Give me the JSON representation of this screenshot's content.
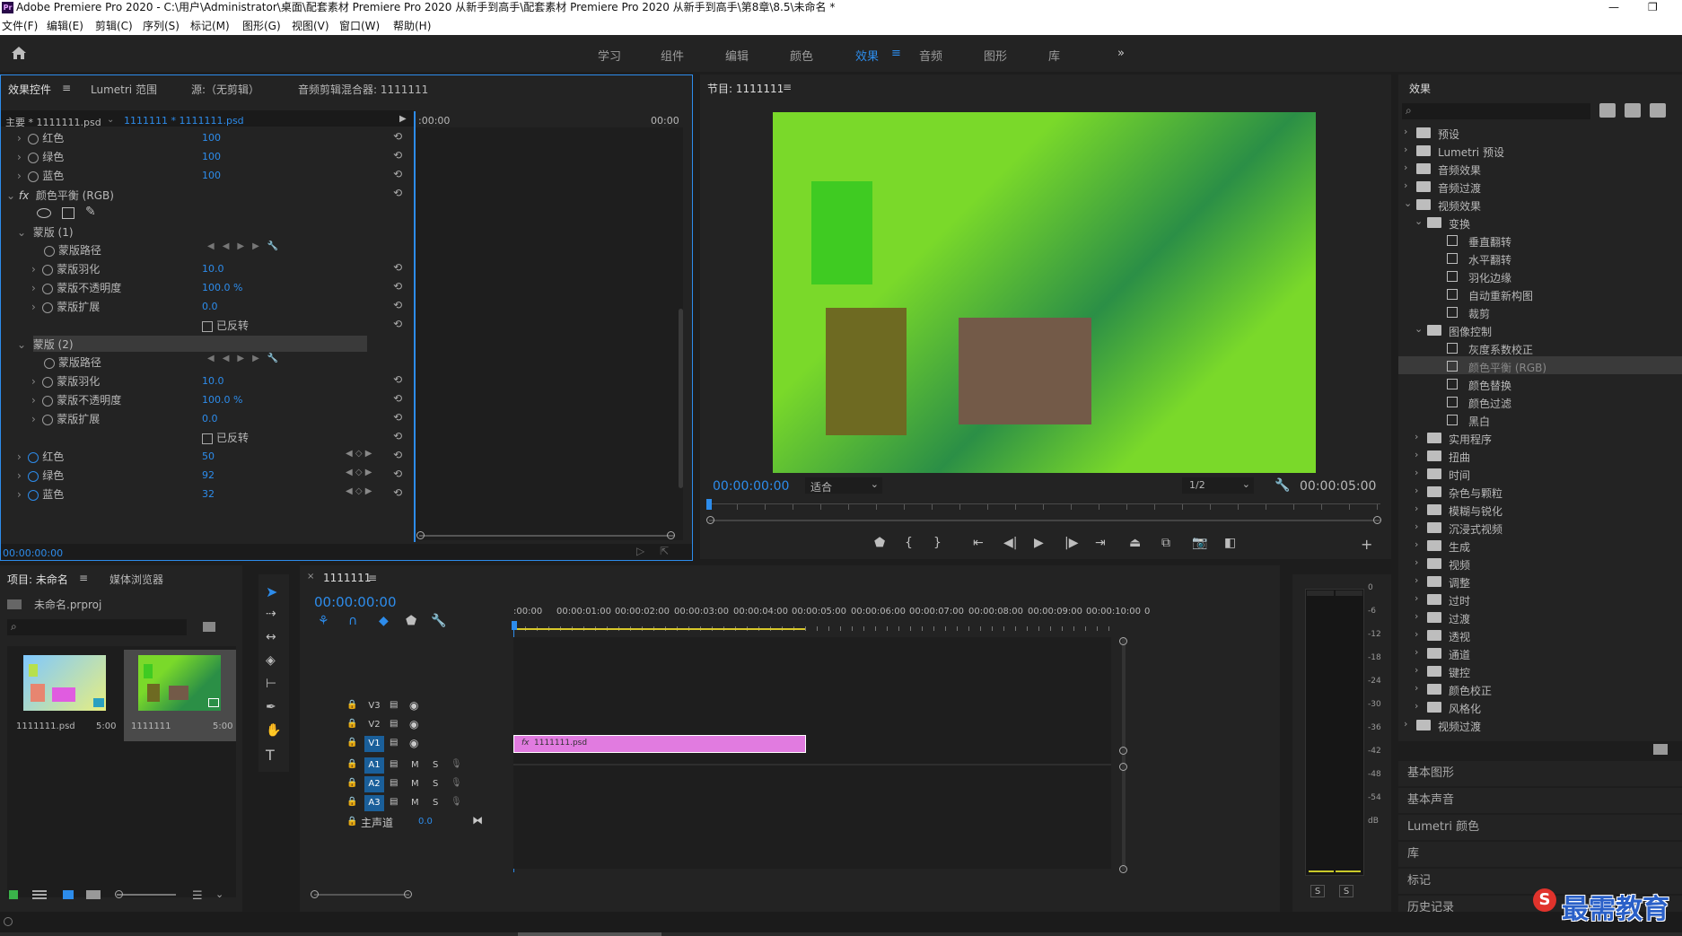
{
  "window": {
    "title": "Adobe Premiere Pro 2020 - C:\\用户\\Administrator\\桌面\\配套素材 Premiere Pro 2020 从新手到高手\\配套素材 Premiere Pro 2020 从新手到高手\\第8章\\8.5\\未命名 *",
    "logo": "Pr",
    "min": "—",
    "max": "❐"
  },
  "menu": [
    "文件(F)",
    "编辑(E)",
    "剪辑(C)",
    "序列(S)",
    "标记(M)",
    "图形(G)",
    "视图(V)",
    "窗口(W)",
    "帮助(H)"
  ],
  "workspaces": [
    "学习",
    "组件",
    "编辑",
    "颜色",
    "效果",
    "音频",
    "图形",
    "库"
  ],
  "workspace_active": "效果",
  "workspace_more": "»",
  "effect_controls": {
    "tabs": [
      "效果控件",
      "Lumetri 范围",
      "源:（无剪辑）",
      "音频剪辑混合器: 1111111"
    ],
    "master": "主要 * 1111111.psd",
    "clip": "1111111 * 1111111.psd",
    "time_start": ":00:00",
    "time_end": "00:00",
    "rows": [
      {
        "label": "红色",
        "value": "100"
      },
      {
        "label": "绿色",
        "value": "100"
      },
      {
        "label": "蓝色",
        "value": "100"
      }
    ],
    "effect_name": "颜色平衡 (RGB)",
    "fx": "fx",
    "mask1": "蒙版 (1)",
    "mask2": "蒙版 (2)",
    "mask_rows": [
      {
        "label": "蒙版路径",
        "value": ""
      },
      {
        "label": "蒙版羽化",
        "value": "10.0"
      },
      {
        "label": "蒙版不透明度",
        "value": "100.0 %"
      },
      {
        "label": "蒙版扩展",
        "value": "0.0"
      }
    ],
    "invert": "已反转",
    "bottom_rows": [
      {
        "label": "红色",
        "value": "50"
      },
      {
        "label": "绿色",
        "value": "92"
      },
      {
        "label": "蓝色",
        "value": "32"
      }
    ],
    "timecode": "00:00:00:00"
  },
  "program": {
    "title": "节目: 1111111",
    "timecode": "00:00:00:00",
    "fit": "适合",
    "resolution": "1/2",
    "duration": "00:00:05:00",
    "colors": {
      "bg1": "#7ad92a",
      "bg2": "#2b8f46",
      "rect1": "#3fcb22",
      "rect2": "#6e6a22",
      "rect3": "#735a48"
    }
  },
  "effects_panel": {
    "title": "效果",
    "tree": [
      {
        "label": "预设",
        "level": 0,
        "type": "folder-star"
      },
      {
        "label": "Lumetri 预设",
        "level": 0,
        "type": "folder-star"
      },
      {
        "label": "音频效果",
        "level": 0,
        "type": "folder"
      },
      {
        "label": "音频过渡",
        "level": 0,
        "type": "folder"
      },
      {
        "label": "视频效果",
        "level": 0,
        "type": "folder",
        "open": true
      },
      {
        "label": "变换",
        "level": 1,
        "type": "folder",
        "open": true
      },
      {
        "label": "垂直翻转",
        "level": 2,
        "type": "fx"
      },
      {
        "label": "水平翻转",
        "level": 2,
        "type": "fx"
      },
      {
        "label": "羽化边缘",
        "level": 2,
        "type": "fx"
      },
      {
        "label": "自动重新构图",
        "level": 2,
        "type": "fx"
      },
      {
        "label": "裁剪",
        "level": 2,
        "type": "fx"
      },
      {
        "label": "图像控制",
        "level": 1,
        "type": "folder",
        "open": true
      },
      {
        "label": "灰度系数校正",
        "level": 2,
        "type": "fx"
      },
      {
        "label": "颜色平衡 (RGB)",
        "level": 2,
        "type": "fx",
        "selected": true
      },
      {
        "label": "颜色替换",
        "level": 2,
        "type": "fx"
      },
      {
        "label": "颜色过滤",
        "level": 2,
        "type": "fx"
      },
      {
        "label": "黑白",
        "level": 2,
        "type": "fx"
      },
      {
        "label": "实用程序",
        "level": 1,
        "type": "folder"
      },
      {
        "label": "扭曲",
        "level": 1,
        "type": "folder"
      },
      {
        "label": "时间",
        "level": 1,
        "type": "folder"
      },
      {
        "label": "杂色与颗粒",
        "level": 1,
        "type": "folder"
      },
      {
        "label": "模糊与锐化",
        "level": 1,
        "type": "folder"
      },
      {
        "label": "沉浸式视频",
        "level": 1,
        "type": "folder"
      },
      {
        "label": "生成",
        "level": 1,
        "type": "folder"
      },
      {
        "label": "视频",
        "level": 1,
        "type": "folder"
      },
      {
        "label": "调整",
        "level": 1,
        "type": "folder"
      },
      {
        "label": "过时",
        "level": 1,
        "type": "folder"
      },
      {
        "label": "过渡",
        "level": 1,
        "type": "folder"
      },
      {
        "label": "透视",
        "level": 1,
        "type": "folder"
      },
      {
        "label": "通道",
        "level": 1,
        "type": "folder"
      },
      {
        "label": "键控",
        "level": 1,
        "type": "folder"
      },
      {
        "label": "颜色校正",
        "level": 1,
        "type": "folder"
      },
      {
        "label": "风格化",
        "level": 1,
        "type": "folder"
      },
      {
        "label": "视频过渡",
        "level": 0,
        "type": "folder"
      }
    ],
    "panels": [
      "基本图形",
      "基本声音",
      "Lumetri 颜色",
      "库",
      "标记",
      "历史记录"
    ]
  },
  "project": {
    "tabs": [
      "项目: 未命名",
      "媒体浏览器"
    ],
    "file": "未命名.prproj",
    "items": [
      {
        "name": "1111111.psd",
        "dur": "5:00"
      },
      {
        "name": "1111111",
        "dur": "5:00"
      }
    ]
  },
  "timeline": {
    "title": "1111111",
    "timecode": "00:00:00:00",
    "ruler": [
      ":00:00",
      "00:00:01:00",
      "00:00:02:00",
      "00:00:03:00",
      "00:00:04:00",
      "00:00:05:00",
      "00:00:06:00",
      "00:00:07:00",
      "00:00:08:00",
      "00:00:09:00",
      "00:00:10:00",
      "0"
    ],
    "video_tracks": [
      "V3",
      "V2",
      "V1"
    ],
    "audio_tracks": [
      "A1",
      "A2",
      "A3"
    ],
    "master": "主声道",
    "master_value": "0.0",
    "clip": "1111111.psd",
    "clip_fx": "fx",
    "clip_color": "#e17be0",
    "audio_m": "M",
    "audio_s": "S"
  },
  "meter": {
    "labels": [
      "0",
      "-6",
      "-12",
      "-18",
      "-24",
      "-30",
      "-36",
      "-42",
      "-48",
      "-54",
      "dB"
    ],
    "solo": [
      "S",
      "S"
    ]
  },
  "watermark": "最需教育"
}
